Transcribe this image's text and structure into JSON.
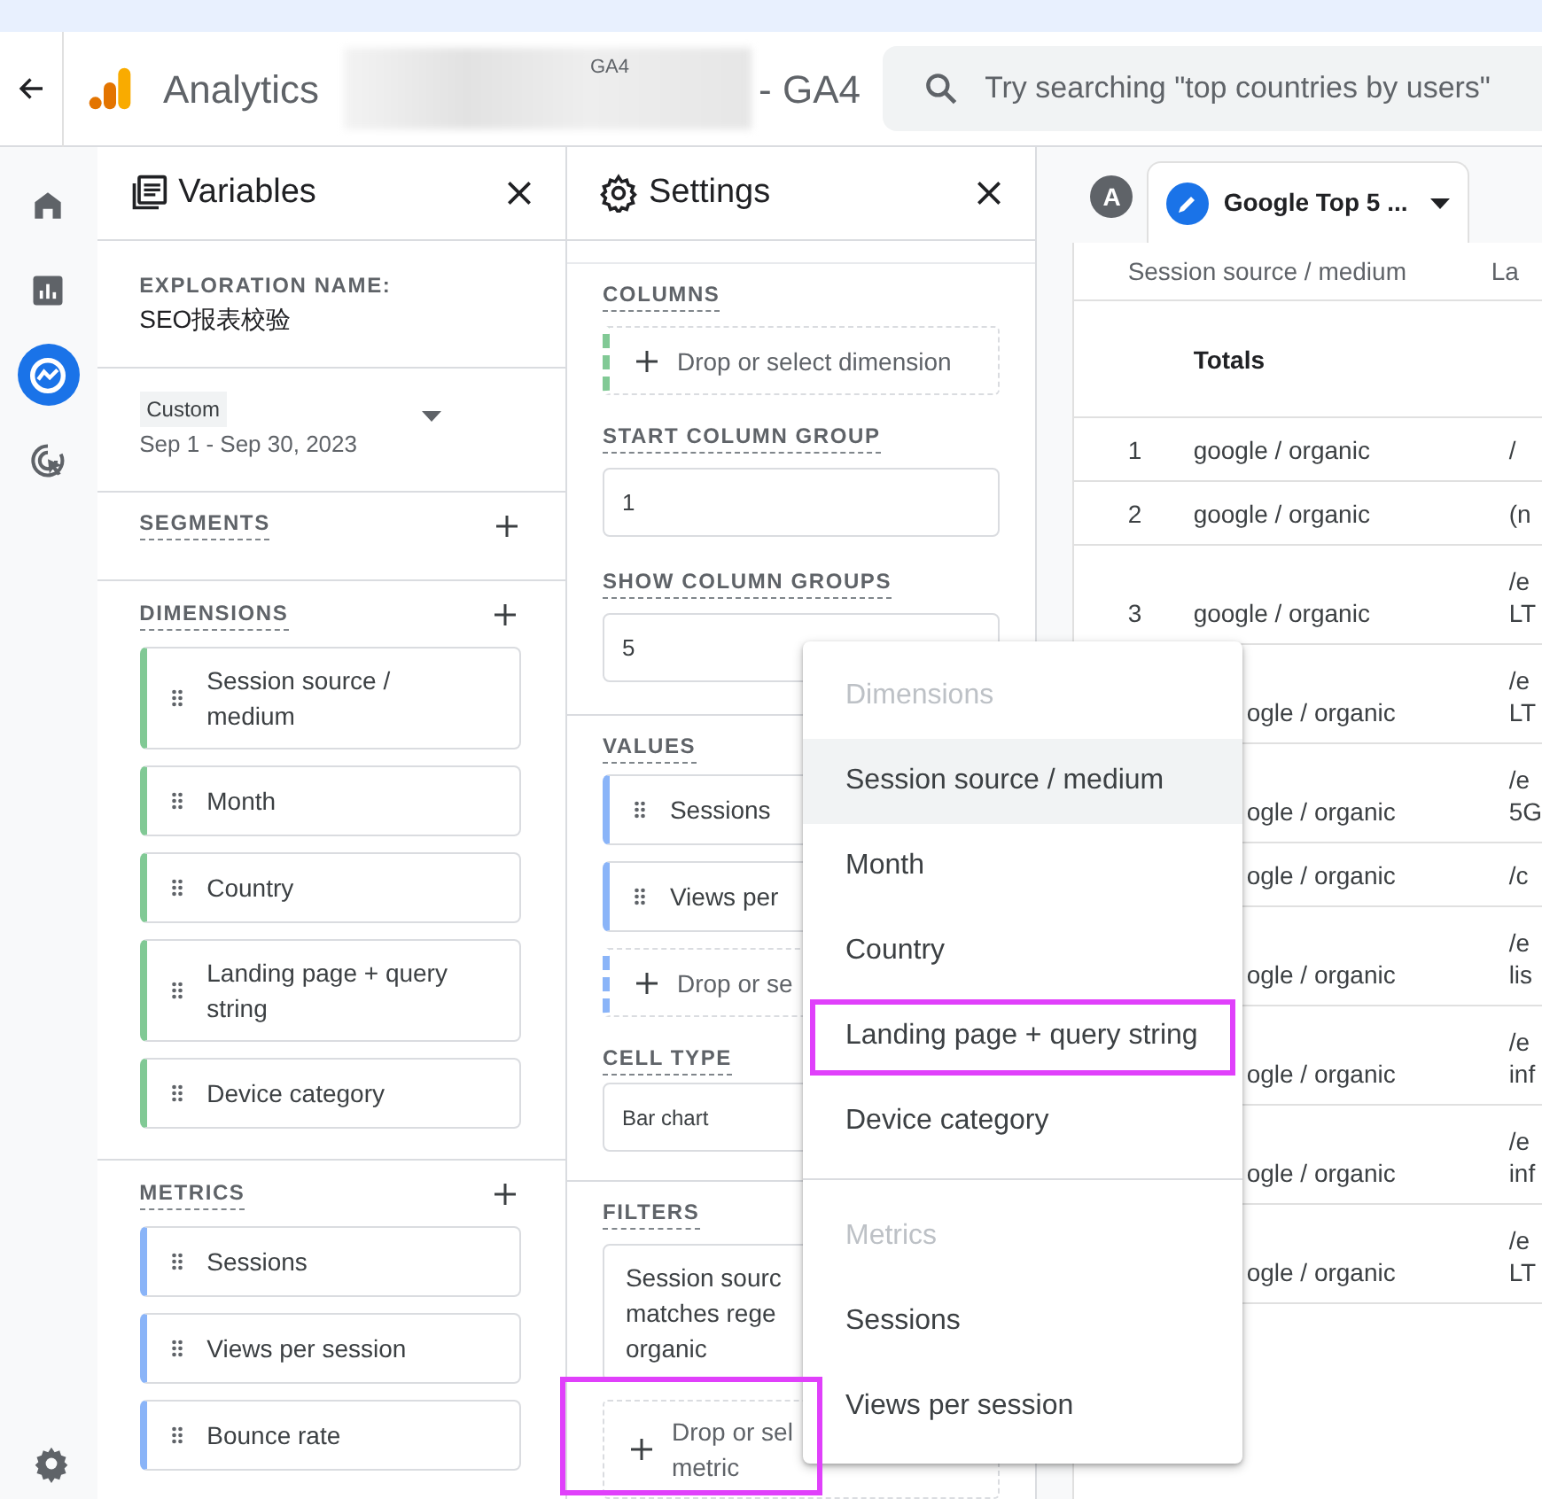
{
  "header": {
    "title": "Analytics",
    "property_tag": "GA4",
    "property_suffix": "- GA4",
    "search": {
      "placeholder": "Try searching \"top countries by users\""
    }
  },
  "nav_rail": {
    "items": [
      {
        "kind": "home",
        "selected": false
      },
      {
        "kind": "reports",
        "selected": false
      },
      {
        "kind": "explore",
        "selected": true
      },
      {
        "kind": "advertising",
        "selected": false
      }
    ],
    "settings": {
      "kind": "settings"
    }
  },
  "variables_panel": {
    "title": "Variables",
    "exploration_name_label": "EXPLORATION NAME:",
    "exploration_name": "SEO报表校验",
    "date_range": {
      "label": "Custom",
      "value": "Sep 1 - Sep 30, 2023"
    },
    "segments": {
      "title": "SEGMENTS"
    },
    "dimensions": {
      "title": "DIMENSIONS",
      "items": [
        "Session source / medium",
        "Month",
        "Country",
        "Landing page + query string",
        "Device category"
      ]
    },
    "metrics": {
      "title": "METRICS",
      "items": [
        "Sessions",
        "Views per session",
        "Bounce rate"
      ]
    }
  },
  "settings_panel": {
    "title": "Settings",
    "columns": {
      "title": "COLUMNS",
      "drop_zone": "Drop or select dimension"
    },
    "start_column_group": {
      "title": "START COLUMN GROUP",
      "value": "1"
    },
    "show_column_groups": {
      "title": "SHOW COLUMN GROUPS",
      "value": "5"
    },
    "values": {
      "title": "VALUES",
      "items": [
        "Sessions",
        "Views per"
      ],
      "drop_zone": "Drop or se"
    },
    "cell_type": {
      "title": "CELL TYPE",
      "value": "Bar chart"
    },
    "filters": {
      "title": "FILTERS",
      "items": [
        "Session sourc\nmatches rege\norganic"
      ],
      "drop_zone": "Drop or sel\nmetric",
      "drop_zone_highlighted": true
    }
  },
  "tabs": [
    {
      "kind": "avatar",
      "label": "A"
    },
    {
      "kind": "tab",
      "label": "Google Top 5 ...",
      "selected": true
    }
  ],
  "table": {
    "columns": [
      "Session source / medium",
      "La"
    ],
    "totals_label": "Totals",
    "rows": [
      {
        "index": "1",
        "source": "google / organic",
        "landing": [
          "/"
        ]
      },
      {
        "index": "2",
        "source": "google / organic",
        "landing": [
          "(n"
        ]
      },
      {
        "index": "3",
        "source": "google / organic",
        "landing": [
          "/e",
          "LT"
        ]
      },
      {
        "source": "ogle / organic",
        "landing": [
          "/e",
          "LT"
        ]
      },
      {
        "source": "ogle / organic",
        "landing": [
          "/e",
          "5G"
        ]
      },
      {
        "source": "ogle / organic",
        "landing": [
          "/c"
        ]
      },
      {
        "source": "ogle / organic",
        "landing": [
          "/e",
          "lis"
        ]
      },
      {
        "source": "ogle / organic",
        "landing": [
          "/e",
          "inf"
        ]
      },
      {
        "source": "ogle / organic",
        "landing": [
          "/e",
          "inf"
        ]
      },
      {
        "source": "ogle / organic",
        "landing": [
          "/e",
          "LT"
        ]
      }
    ]
  },
  "menu": {
    "items": [
      {
        "kind": "header",
        "label": "Dimensions"
      },
      {
        "kind": "option",
        "label": "Session source / medium",
        "hovered": true,
        "highlighted": false
      },
      {
        "kind": "option",
        "label": "Month",
        "hovered": false,
        "highlighted": false
      },
      {
        "kind": "option",
        "label": "Country",
        "hovered": false,
        "highlighted": false
      },
      {
        "kind": "option",
        "label": "Landing page + query string",
        "hovered": false,
        "highlighted": true
      },
      {
        "kind": "option",
        "label": "Device category",
        "hovered": false,
        "highlighted": false
      },
      {
        "kind": "divider"
      },
      {
        "kind": "header",
        "label": "Metrics"
      },
      {
        "kind": "option",
        "label": "Sessions",
        "hovered": false,
        "highlighted": false
      },
      {
        "kind": "option",
        "label": "Views per session",
        "hovered": false,
        "highlighted": false
      }
    ]
  }
}
